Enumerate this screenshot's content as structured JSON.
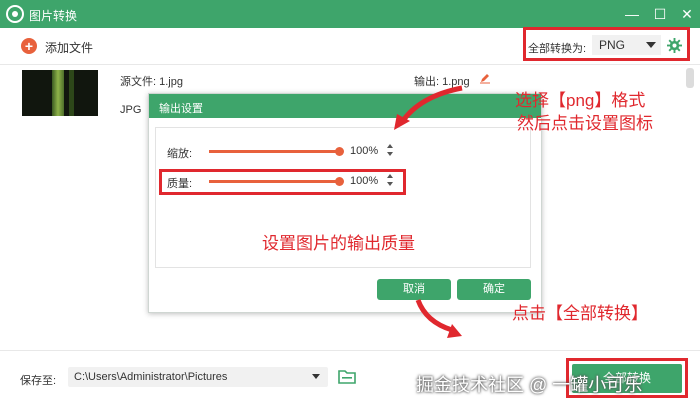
{
  "window": {
    "title": "图片转换",
    "minimize": "—",
    "maximize": "☐",
    "close": "✕"
  },
  "toolbar": {
    "add_file_label": "添加文件",
    "convert_all_label": "全部转换为:",
    "format_value": "PNG",
    "icons": [
      "plus-icon",
      "gear-icon",
      "chevron-down-icon"
    ]
  },
  "file": {
    "source_label": "源文件: 1.jpg",
    "format_label": "JPG",
    "output_label": "输出: 1.png"
  },
  "dialog": {
    "title": "输出设置",
    "scale": {
      "label": "缩放:",
      "value": "100%",
      "level": 1.0
    },
    "quality": {
      "label": "质量:",
      "value": "100%",
      "level": 1.0
    },
    "cancel_label": "取消",
    "ok_label": "确定"
  },
  "annotations": {
    "format_hint_line1": "选择【png】格式",
    "format_hint_line2": "然后点击设置图标",
    "quality_hint": "设置图片的输出质量",
    "convert_hint": "点击【全部转换】"
  },
  "bottom": {
    "save_label": "保存至:",
    "save_path": "C:\\Users\\Administrator\\Pictures",
    "convert_button_label": "全部转换"
  },
  "watermark": "掘金技术社区 @ 一罐小可乐",
  "colors": {
    "brand_green": "#3ea56b",
    "accent_orange": "#e8613c",
    "annotation_red": "#e0282e"
  }
}
